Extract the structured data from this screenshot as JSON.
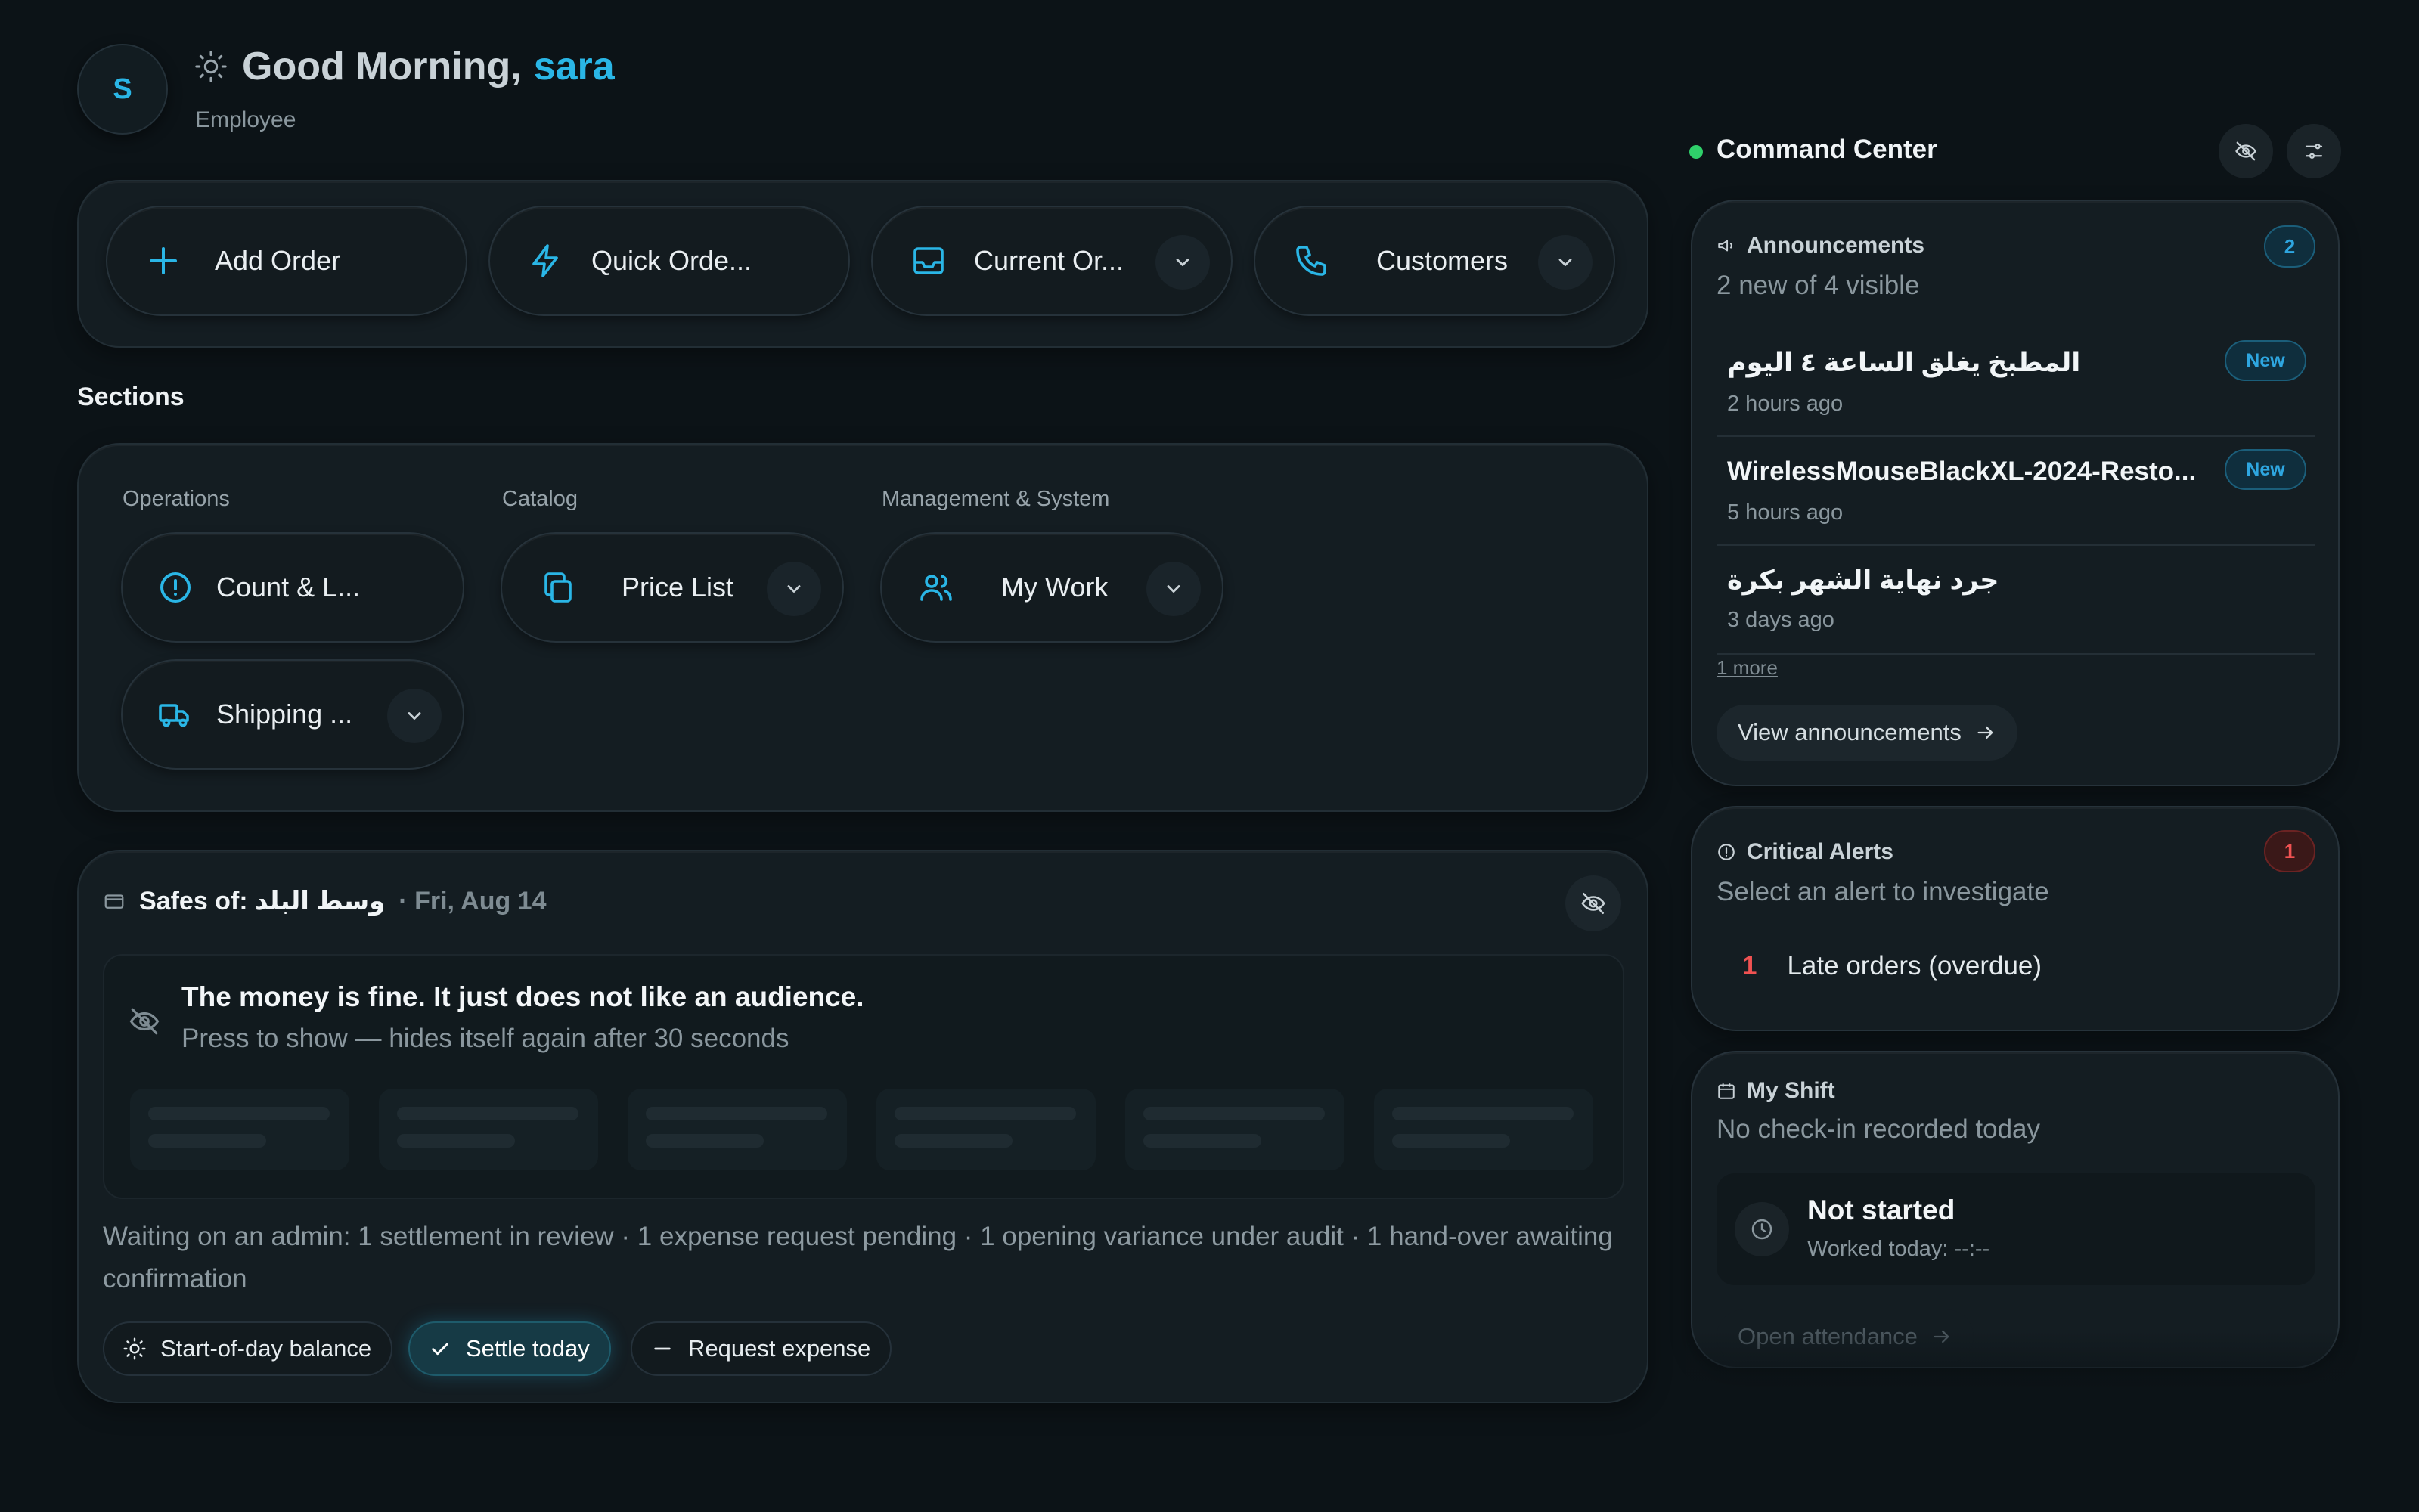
{
  "user": {
    "initial": "S",
    "greeting": "Good Morning,",
    "name": "sara",
    "role": "Employee"
  },
  "quick_actions": [
    {
      "label": "Add Order",
      "icon": "plus-icon"
    },
    {
      "label": "Quick Orde...",
      "icon": "lightning-icon"
    },
    {
      "label": "Current Or...",
      "icon": "inbox-icon",
      "has_dropdown": true
    },
    {
      "label": "Customers",
      "icon": "phone-icon",
      "has_dropdown": true
    }
  ],
  "sections": {
    "title": "Sections",
    "groups": [
      {
        "label": "Operations",
        "items": [
          {
            "label": "Count & L...",
            "icon": "alert-circle-icon"
          },
          {
            "label": "Shipping ...",
            "icon": "truck-icon",
            "has_dropdown": true
          }
        ]
      },
      {
        "label": "Catalog",
        "items": [
          {
            "label": "Price List",
            "icon": "copy-icon",
            "has_dropdown": true
          }
        ]
      },
      {
        "label": "Management & System",
        "items": [
          {
            "label": "My Work",
            "icon": "users-icon",
            "has_dropdown": true
          }
        ]
      }
    ]
  },
  "safes": {
    "title": "Safes of: وسط البلد",
    "date": "· Fri, Aug 14",
    "hidden_title": "The money is fine. It just does not like an audience.",
    "hidden_sub": "Press to show — hides itself again after 30 seconds",
    "waiting": "Waiting on an admin: 1 settlement in review · 1 expense request pending · 1 opening variance under audit · 1 hand-over awaiting confirmation",
    "actions": [
      {
        "label": "Start-of-day balance",
        "icon": "sun-icon"
      },
      {
        "label": "Settle today",
        "icon": "check-icon",
        "primary": true
      },
      {
        "label": "Request expense",
        "icon": "minus-icon"
      }
    ]
  },
  "command_center": {
    "title": "Command Center",
    "status_color": "#2fd06a",
    "announcements": {
      "title": "Announcements",
      "count": "2",
      "subtitle": "2 new of 4 visible",
      "items": [
        {
          "title": "المطبخ يغلق الساعة ٤ اليوم",
          "time": "2 hours ago",
          "badge": "New"
        },
        {
          "title": "WirelessMouseBlackXL-2024-Resto...",
          "time": "5 hours ago",
          "badge": "New"
        },
        {
          "title": "جرد نهاية الشهر بكرة",
          "time": "3 days ago",
          "badge": ""
        }
      ],
      "more": "1 more",
      "view_label": "View announcements"
    },
    "alerts": {
      "title": "Critical Alerts",
      "count": "1",
      "subtitle": "Select an alert to investigate",
      "items": [
        {
          "count": "1",
          "label": "Late orders (overdue)"
        }
      ]
    },
    "shift": {
      "title": "My Shift",
      "subtitle": "No check-in recorded today",
      "status": "Not started",
      "worked": "Worked today: --:--",
      "open_label": "Open attendance"
    }
  },
  "colors": {
    "accent": "#2ab6e6",
    "background": "#0c1317",
    "alert": "#f05252"
  }
}
